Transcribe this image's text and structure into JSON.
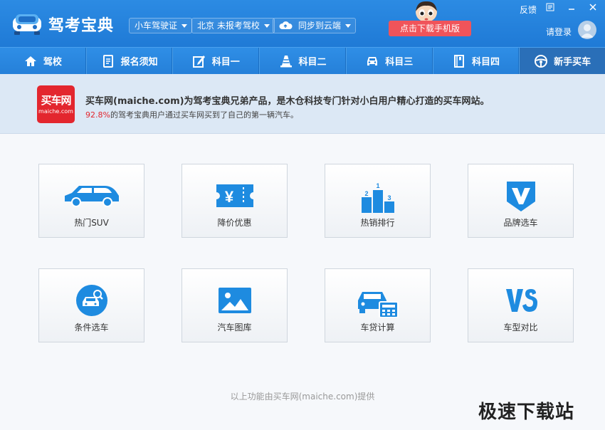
{
  "app": {
    "title": "驾考宝典",
    "vehicle_select": "小车驾驶证",
    "region_select": "北京 未报考驾校",
    "sync_button": "同步到云端",
    "download_button": "点击下载手机版",
    "feedback": "反馈",
    "login": "请登录"
  },
  "nav": {
    "tabs": [
      {
        "label": "驾校",
        "icon": "home-icon"
      },
      {
        "label": "报名须知",
        "icon": "document-icon"
      },
      {
        "label": "科目一",
        "icon": "pencil-icon"
      },
      {
        "label": "科目二",
        "icon": "traffic-cone-icon"
      },
      {
        "label": "科目三",
        "icon": "car-front-icon"
      },
      {
        "label": "科目四",
        "icon": "book-icon"
      },
      {
        "label": "新手买车",
        "icon": "steering-wheel-icon"
      }
    ],
    "active": "新手买车"
  },
  "banner": {
    "logo_text": "买车网",
    "logo_sub": "maiche.com",
    "line1": "买车网(maiche.com)为驾考宝典兄弟产品，是木仓科技专门针对小白用户精心打造的买车网站。",
    "line2_pct": "92.8%",
    "line2_rest": "的驾考宝典用户通过买车网买到了自己的第一辆汽车。"
  },
  "features": [
    {
      "label": "热门SUV",
      "icon": "suv-icon"
    },
    {
      "label": "降价优惠",
      "icon": "coupon-icon"
    },
    {
      "label": "热销排行",
      "icon": "podium-icon"
    },
    {
      "label": "品牌选车",
      "icon": "brand-shield-icon"
    },
    {
      "label": "条件选车",
      "icon": "car-search-icon"
    },
    {
      "label": "汽车图库",
      "icon": "picture-icon"
    },
    {
      "label": "车贷计算",
      "icon": "car-calculator-icon"
    },
    {
      "label": "车型对比",
      "icon": "vs-icon"
    }
  ],
  "footer_note": "以上功能由买车网(maiche.com)提供",
  "watermark": "极速下载站",
  "colors": {
    "primary": "#2580d9",
    "accent_blue": "#1e8be0",
    "brand_red": "#e3262e",
    "download_red": "#f0545a"
  }
}
